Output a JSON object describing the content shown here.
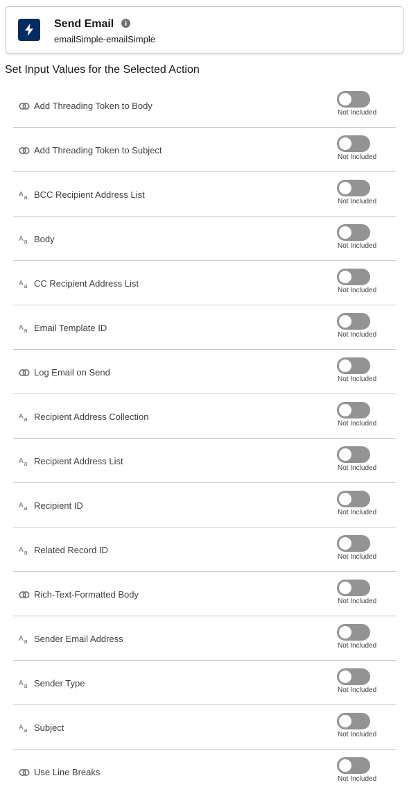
{
  "action": {
    "title": "Send Email",
    "subtitle": "emailSimple-emailSimple",
    "icon": "lightning-bolt-icon",
    "icon_color": "#032d60"
  },
  "section_title": "Set Input Values for the Selected Action",
  "toggle_off_color": "#939393",
  "parameters": [
    {
      "label": "Add Threading Token to Body",
      "type": "boolean",
      "status": "Not Included"
    },
    {
      "label": "Add Threading Token to Subject",
      "type": "boolean",
      "status": "Not Included"
    },
    {
      "label": "BCC Recipient Address List",
      "type": "text",
      "status": "Not Included"
    },
    {
      "label": "Body",
      "type": "text",
      "status": "Not Included"
    },
    {
      "label": "CC Recipient Address List",
      "type": "text",
      "status": "Not Included"
    },
    {
      "label": "Email Template ID",
      "type": "text",
      "status": "Not Included"
    },
    {
      "label": "Log Email on Send",
      "type": "boolean",
      "status": "Not Included"
    },
    {
      "label": "Recipient Address Collection",
      "type": "text",
      "status": "Not Included"
    },
    {
      "label": "Recipient Address List",
      "type": "text",
      "status": "Not Included"
    },
    {
      "label": "Recipient ID",
      "type": "text",
      "status": "Not Included"
    },
    {
      "label": "Related Record ID",
      "type": "text",
      "status": "Not Included"
    },
    {
      "label": "Rich-Text-Formatted Body",
      "type": "boolean",
      "status": "Not Included"
    },
    {
      "label": "Sender Email Address",
      "type": "text",
      "status": "Not Included"
    },
    {
      "label": "Sender Type",
      "type": "text",
      "status": "Not Included"
    },
    {
      "label": "Subject",
      "type": "text",
      "status": "Not Included"
    },
    {
      "label": "Use Line Breaks",
      "type": "boolean",
      "status": "Not Included"
    }
  ]
}
